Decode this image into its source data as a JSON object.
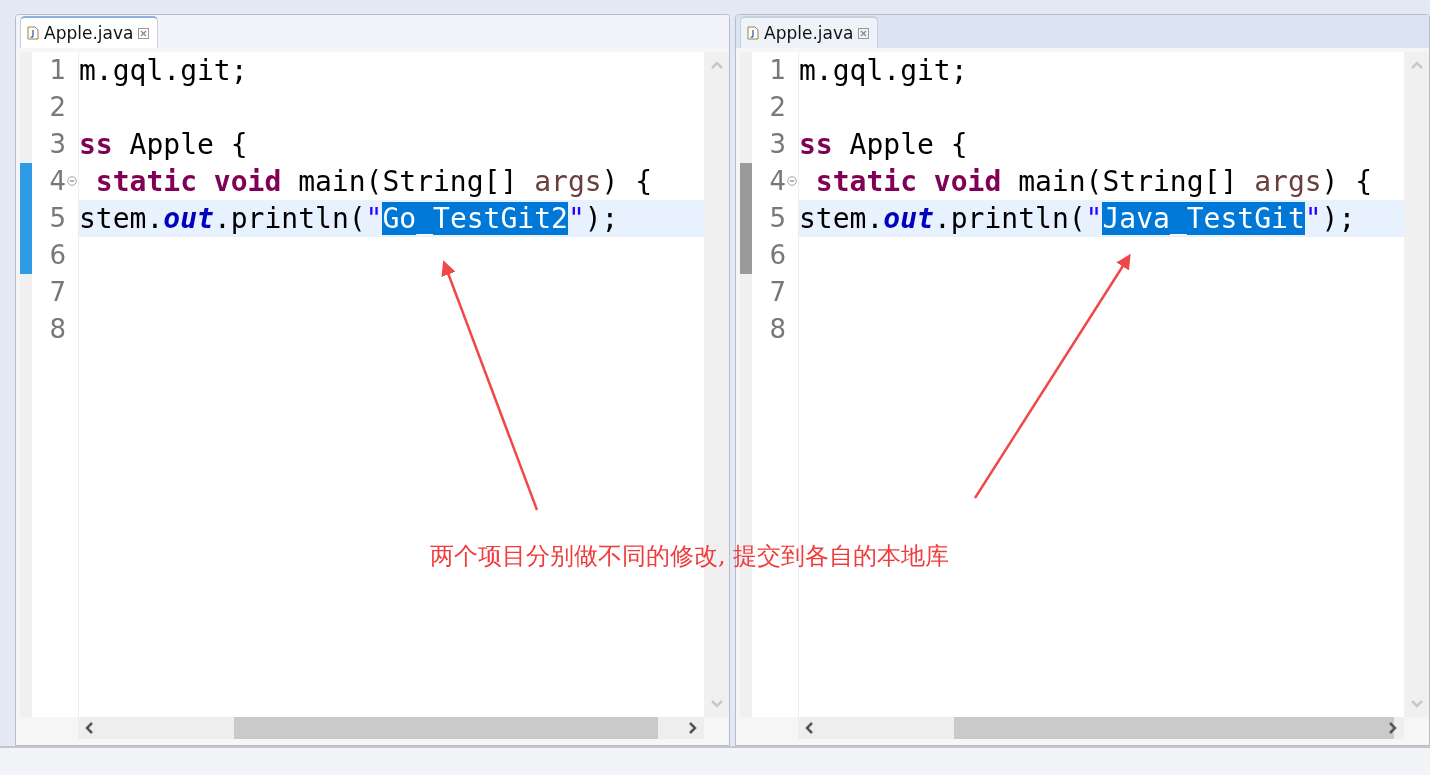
{
  "editors": [
    {
      "tab": {
        "title": "Apple.java",
        "selected": true
      },
      "change_bar": {
        "color": "#2e9be6"
      },
      "lines": [
        {
          "number": "1",
          "current": false,
          "fold": false,
          "changed": false,
          "tokens": [
            {
              "kind": "plain",
              "text": "m.gql.git;"
            }
          ]
        },
        {
          "number": "2",
          "current": false,
          "fold": false,
          "changed": false
        },
        {
          "number": "3",
          "current": false,
          "fold": false,
          "changed": false,
          "tokens": [
            {
              "kind": "keyword",
              "text": "ss"
            },
            {
              "kind": "plain",
              "text": " Apple {"
            }
          ]
        },
        {
          "number": "4",
          "current": false,
          "fold": true,
          "changed": true,
          "tokens": [
            {
              "kind": "keyword",
              "text": " static void"
            },
            {
              "kind": "plain",
              "text": " main(String[] "
            },
            {
              "kind": "param",
              "text": "args"
            },
            {
              "kind": "plain",
              "text": ") {"
            }
          ]
        },
        {
          "number": "5",
          "current": true,
          "fold": false,
          "changed": true,
          "tokens": [
            {
              "kind": "plain",
              "text": "stem."
            },
            {
              "kind": "field",
              "text": "out"
            },
            {
              "kind": "plain",
              "text": ".println("
            },
            {
              "kind": "string",
              "text": "\""
            },
            {
              "kind": "selected",
              "text": "Go_TestGit2"
            },
            {
              "kind": "string",
              "text": "\""
            },
            {
              "kind": "plain",
              "text": ");"
            }
          ]
        },
        {
          "number": "6",
          "current": false,
          "fold": false,
          "changed": true
        },
        {
          "number": "7",
          "current": false,
          "fold": false,
          "changed": false
        },
        {
          "number": "8",
          "current": false,
          "fold": false,
          "changed": false
        }
      ]
    },
    {
      "tab": {
        "title": "Apple.java",
        "selected": false
      },
      "change_bar": {
        "color": "#9a9a9a"
      },
      "lines": [
        {
          "number": "1",
          "current": false,
          "fold": false,
          "changed": false,
          "tokens": [
            {
              "kind": "plain",
              "text": "m.gql.git;"
            }
          ]
        },
        {
          "number": "2",
          "current": false,
          "fold": false,
          "changed": false
        },
        {
          "number": "3",
          "current": false,
          "fold": false,
          "changed": false,
          "tokens": [
            {
              "kind": "keyword",
              "text": "ss"
            },
            {
              "kind": "plain",
              "text": " Apple {"
            }
          ]
        },
        {
          "number": "4",
          "current": false,
          "fold": true,
          "changed": true,
          "tokens": [
            {
              "kind": "keyword",
              "text": " static void"
            },
            {
              "kind": "plain",
              "text": " main(String[] "
            },
            {
              "kind": "param",
              "text": "args"
            },
            {
              "kind": "plain",
              "text": ") {"
            }
          ]
        },
        {
          "number": "5",
          "current": true,
          "fold": false,
          "changed": true,
          "tokens": [
            {
              "kind": "plain",
              "text": "stem."
            },
            {
              "kind": "field",
              "text": "out"
            },
            {
              "kind": "plain",
              "text": ".println("
            },
            {
              "kind": "string",
              "text": "\""
            },
            {
              "kind": "selected",
              "text": "Java_TestGit"
            },
            {
              "kind": "string",
              "text": "\""
            },
            {
              "kind": "plain",
              "text": ");"
            }
          ]
        },
        {
          "number": "6",
          "current": false,
          "fold": false,
          "changed": true
        },
        {
          "number": "7",
          "current": false,
          "fold": false,
          "changed": false
        },
        {
          "number": "8",
          "current": false,
          "fold": false,
          "changed": false
        }
      ]
    }
  ],
  "annotation": {
    "text": "两个项目分别做不同的修改, 提交到各自的本地库"
  }
}
